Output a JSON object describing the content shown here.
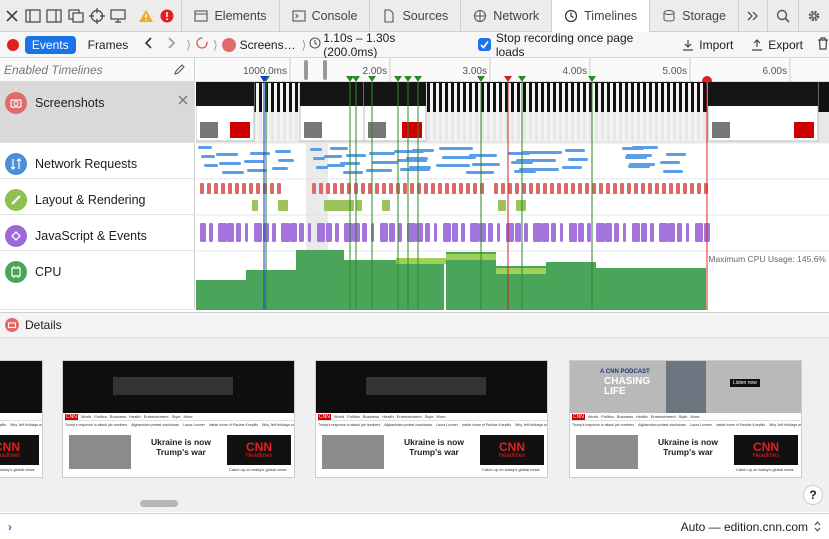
{
  "tabs": [
    {
      "label": "Elements",
      "icon": "elements-icon"
    },
    {
      "label": "Console",
      "icon": "console-icon"
    },
    {
      "label": "Sources",
      "icon": "sources-icon"
    },
    {
      "label": "Network",
      "icon": "network-icon"
    },
    {
      "label": "Timelines",
      "icon": "timelines-icon",
      "active": true
    },
    {
      "label": "Storage",
      "icon": "storage-icon"
    }
  ],
  "toolbar": {
    "events_label": "Events",
    "frames_label": "Frames",
    "breadcrumb_screenshots": "Screens…",
    "range": "1.10s – 1.30s (200.0ms)",
    "stop_recording_label": "Stop recording once page loads",
    "import_label": "Import",
    "export_label": "Export"
  },
  "sidebar": {
    "header": "Enabled Timelines",
    "timelines": [
      {
        "label": "Screenshots",
        "icon": "camera-icon",
        "color": "#e16b6b"
      },
      {
        "label": "Network Requests",
        "icon": "network-requests-icon",
        "color": "#4a8fd8"
      },
      {
        "label": "Layout & Rendering",
        "icon": "brush-icon",
        "color": "#8dc152"
      },
      {
        "label": "JavaScript & Events",
        "icon": "script-icon",
        "color": "#9b6ad6"
      },
      {
        "label": "CPU",
        "icon": "cpu-icon",
        "color": "#4aa55b"
      }
    ]
  },
  "ruler": {
    "ticks": [
      "1000.0ms",
      "2.00s",
      "3.00s",
      "4.00s",
      "5.00s",
      "6.00s"
    ]
  },
  "cpu": {
    "max_label": "Maximum CPU Usage: 145.6%"
  },
  "details": {
    "label": "Details"
  },
  "frame_content": {
    "headline": "Ukraine is now Trump's war",
    "logo": "CNN",
    "headlines_label": "Headlines",
    "podcast_title": "CHASING LIFE",
    "podcast_prefix": "A CNN PODCAST",
    "listen_now": "Listen now",
    "nav": [
      "World",
      "Politics",
      "Business",
      "Health",
      "Entertainment",
      "Style",
      "More"
    ],
    "tickers": [
      "Trump's response to attack job numbers",
      "Afghanistan protest crackdown",
      "Laura Loomer",
      "Inside home of Pauline Kuepfitz",
      "Why Jeff Holidays went"
    ],
    "caption": "Catch up on today's global news"
  },
  "status": {
    "target": "Auto — edition.cnn.com"
  },
  "colors": {
    "accent": "#1a73e8",
    "screenshot": "#e16b6b",
    "network": "#4a8fd8",
    "layout": "#d86a6a",
    "layout_green": "#9bc25b",
    "js": "#a374db",
    "cpu": "#4aa55b",
    "recording": "#e02020"
  }
}
